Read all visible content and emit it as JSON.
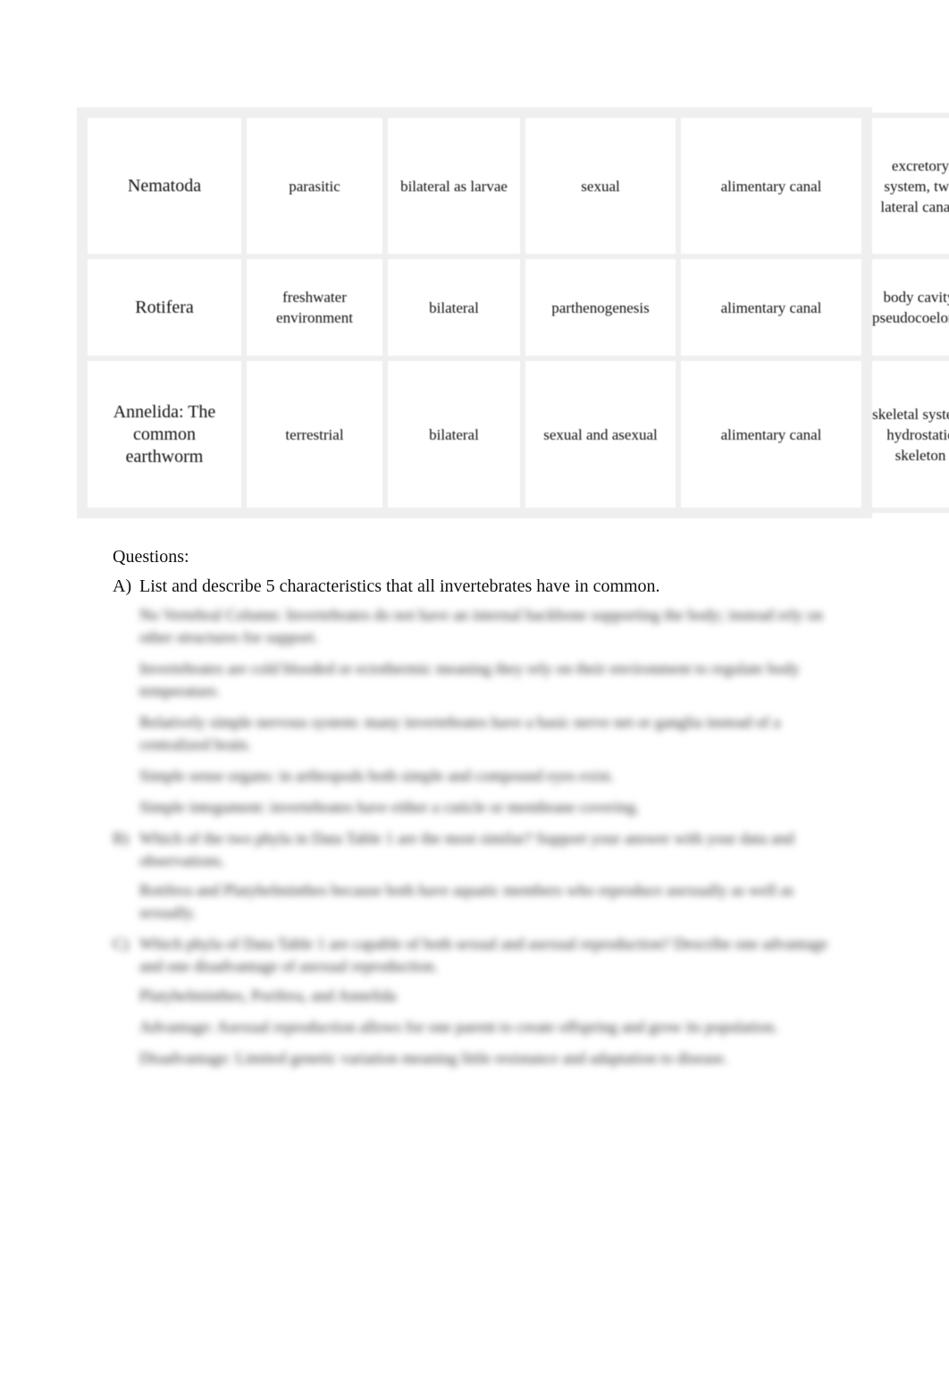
{
  "table": {
    "rows": [
      {
        "phylum": "Nematoda",
        "habitat": "parasitic",
        "symmetry": "bilateral as larvae",
        "reproduction": "sexual",
        "digestion": "alimentary canal",
        "other": "excretory system, two lateral canals"
      },
      {
        "phylum": "Rotifera",
        "habitat": "freshwater environment",
        "symmetry": "bilateral",
        "reproduction": "parthenogenesis",
        "digestion": "alimentary canal",
        "other": "body cavity, pseudocoelomate"
      },
      {
        "phylum": "Annelida: The common earthworm",
        "habitat": "terrestrial",
        "symmetry": "bilateral",
        "reproduction": "sexual and asexual",
        "digestion": "alimentary canal",
        "other": "skeletal system, hydrostatic skeleton"
      }
    ]
  },
  "questions": {
    "heading": "Questions:",
    "items": [
      {
        "label": "A)",
        "text": "List and describe 5 characteristics that all invertebrates have in common.",
        "answers": [
          "No Vertebral Column: Invertebrates do not have an internal backbone supporting the body; instead rely on other structures for support.",
          "Invertebrates are cold blooded or ectothermic meaning they rely on their environment to regulate body temperature.",
          "Relatively simple nervous system: many invertebrates have a basic nerve net or ganglia instead of a centralized brain.",
          "Simple sense organs: in arthropods both simple and compound eyes exist.",
          "Simple integument: invertebrates have either a cuticle or membrane covering."
        ]
      },
      {
        "label": "B)",
        "text": "Which of the two phyla in Data Table 1 are the most similar? Support your answer with your data and observations.",
        "answers": [
          "Rotifera and Platyhelminthes because both have aquatic members who reproduce asexually as well as sexually."
        ]
      },
      {
        "label": "C)",
        "text": "Which phyla of Data Table 1 are capable of both sexual and asexual reproduction? Describe one advantage and one disadvantage of asexual reproduction.",
        "answers": [
          "Platyhelminthes, Porifera, and Annelida",
          "Advantage: Asexual reproduction allows for one parent to create offspring and grow its population.",
          "Disadvantage: Limited genetic variation meaning little resistance and adaptation to disease."
        ]
      }
    ]
  }
}
